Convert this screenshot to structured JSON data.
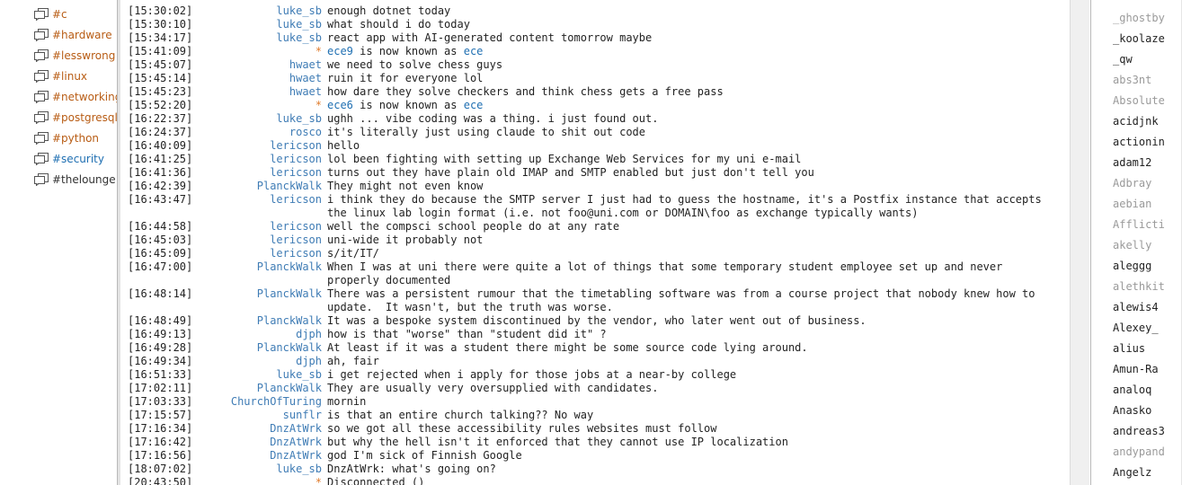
{
  "sidebar": {
    "channels": [
      {
        "label": "#c",
        "state": "unread"
      },
      {
        "label": "#hardware",
        "state": "unread"
      },
      {
        "label": "#lesswrong",
        "state": "unread"
      },
      {
        "label": "#linux",
        "state": "unread"
      },
      {
        "label": "#networking",
        "state": "unread"
      },
      {
        "label": "#postgresql",
        "state": "unread"
      },
      {
        "label": "#python",
        "state": "unread"
      },
      {
        "label": "#security",
        "state": "current"
      },
      {
        "label": "#thelounge",
        "state": "read"
      }
    ]
  },
  "messages": [
    {
      "ts": "[15:30:02]",
      "nick": "luke_sb",
      "type": "normal",
      "text": "enough dotnet today"
    },
    {
      "ts": "[15:30:10]",
      "nick": "luke_sb",
      "type": "normal",
      "text": "what should i do today"
    },
    {
      "ts": "[15:34:17]",
      "nick": "luke_sb",
      "type": "normal",
      "text": "react app with AI-generated content tomorrow maybe"
    },
    {
      "ts": "[15:41:09]",
      "nick": "*",
      "type": "nickchange",
      "from": "ece9",
      "mid": " is now known as ",
      "to": "ece"
    },
    {
      "ts": "[15:45:07]",
      "nick": "hwaet",
      "type": "normal",
      "text": "we need to solve chess guys"
    },
    {
      "ts": "[15:45:14]",
      "nick": "hwaet",
      "type": "normal",
      "text": "ruin it for everyone lol"
    },
    {
      "ts": "[15:45:23]",
      "nick": "hwaet",
      "type": "normal",
      "text": "how dare they solve checkers and think chess gets a free pass"
    },
    {
      "ts": "[15:52:20]",
      "nick": "*",
      "type": "nickchange",
      "from": "ece6",
      "mid": " is now known as ",
      "to": "ece"
    },
    {
      "ts": "[16:22:37]",
      "nick": "luke_sb",
      "type": "normal",
      "text": "ughh ... vibe coding was a thing. i just found out."
    },
    {
      "ts": "[16:24:37]",
      "nick": "rosco",
      "type": "normal",
      "text": "it's literally just using claude to shit out code"
    },
    {
      "ts": "[16:40:09]",
      "nick": "lericson",
      "type": "normal",
      "text": "hello"
    },
    {
      "ts": "[16:41:25]",
      "nick": "lericson",
      "type": "normal",
      "text": "lol been fighting with setting up Exchange Web Services for my uni e-mail"
    },
    {
      "ts": "[16:41:36]",
      "nick": "lericson",
      "type": "normal",
      "text": "turns out they have plain old IMAP and SMTP enabled but just don't tell you"
    },
    {
      "ts": "[16:42:39]",
      "nick": "PlanckWalk",
      "type": "normal",
      "text": "They might not even know"
    },
    {
      "ts": "[16:43:47]",
      "nick": "lericson",
      "type": "normal",
      "text": "i think they do because the SMTP server I just had to guess the hostname, it's a Postfix instance that accepts the linux lab login format (i.e. not foo@uni.com or DOMAIN\\foo as exchange typically wants)"
    },
    {
      "ts": "[16:44:58]",
      "nick": "lericson",
      "type": "normal",
      "text": "well the compsci school people do at any rate"
    },
    {
      "ts": "[16:45:03]",
      "nick": "lericson",
      "type": "normal",
      "text": "uni-wide it probably not"
    },
    {
      "ts": "[16:45:09]",
      "nick": "lericson",
      "type": "normal",
      "text": "s/it/IT/"
    },
    {
      "ts": "[16:47:00]",
      "nick": "PlanckWalk",
      "type": "normal",
      "text": "When I was at uni there were quite a lot of things that some temporary student employee set up and never properly documented"
    },
    {
      "ts": "[16:48:14]",
      "nick": "PlanckWalk",
      "type": "normal",
      "text": "There was a persistent rumour that the timetabling software was from a course project that nobody knew how to update.  It wasn't, but the truth was worse."
    },
    {
      "ts": "[16:48:49]",
      "nick": "PlanckWalk",
      "type": "normal",
      "text": "It was a bespoke system discontinued by the vendor, who later went out of business."
    },
    {
      "ts": "[16:49:13]",
      "nick": "djph",
      "type": "normal",
      "text": "how is that \"worse\" than \"student did it\" ?"
    },
    {
      "ts": "[16:49:28]",
      "nick": "PlanckWalk",
      "type": "normal",
      "text": "At least if it was a student there might be some source code lying around."
    },
    {
      "ts": "[16:49:34]",
      "nick": "djph",
      "type": "normal",
      "text": "ah, fair"
    },
    {
      "ts": "[16:51:33]",
      "nick": "luke_sb",
      "type": "normal",
      "text": "i get rejected when i apply for those jobs at a near-by college"
    },
    {
      "ts": "[17:02:11]",
      "nick": "PlanckWalk",
      "type": "normal",
      "text": "They are usually very oversupplied with candidates."
    },
    {
      "ts": "[17:03:33]",
      "nick": "ChurchOfTuring",
      "type": "normal",
      "text": "mornin"
    },
    {
      "ts": "[17:15:57]",
      "nick": "sunflr",
      "type": "normal",
      "text": "is that an entire church talking?? No way"
    },
    {
      "ts": "[17:16:34]",
      "nick": "DnzAtWrk",
      "type": "normal",
      "text": "so we got all these accessibility rules websites must follow"
    },
    {
      "ts": "[17:16:42]",
      "nick": "DnzAtWrk",
      "type": "normal",
      "text": "but why the hell isn't it enforced that they cannot use IP localization"
    },
    {
      "ts": "[17:16:56]",
      "nick": "DnzAtWrk",
      "type": "normal",
      "text": "god I'm sick of Finnish Google"
    },
    {
      "ts": "[18:07:02]",
      "nick": "luke_sb",
      "type": "normal",
      "text": "DnzAtWrk: what's going on?"
    },
    {
      "ts": "[20:43:50]",
      "nick": "*",
      "type": "system",
      "text": "Disconnected ()"
    }
  ],
  "users": [
    {
      "name": "_ghostby",
      "away": true
    },
    {
      "name": "_koolaze",
      "away": false
    },
    {
      "name": "_qw",
      "away": false
    },
    {
      "name": "abs3nt",
      "away": true
    },
    {
      "name": "Absolute",
      "away": true
    },
    {
      "name": "acidjnk",
      "away": false
    },
    {
      "name": "actionin",
      "away": false
    },
    {
      "name": "adam12",
      "away": false
    },
    {
      "name": "Adbray",
      "away": true
    },
    {
      "name": "aebian",
      "away": true
    },
    {
      "name": "Afflicti",
      "away": true
    },
    {
      "name": "akelly",
      "away": true
    },
    {
      "name": "aleggg",
      "away": false
    },
    {
      "name": "alethkit",
      "away": true
    },
    {
      "name": "alewis4",
      "away": false
    },
    {
      "name": "Alexey_",
      "away": false
    },
    {
      "name": "alius",
      "away": false
    },
    {
      "name": "Amun-Ra",
      "away": false
    },
    {
      "name": "analoq",
      "away": false
    },
    {
      "name": "Anasko",
      "away": false
    },
    {
      "name": "andreas3",
      "away": false
    },
    {
      "name": "andypand",
      "away": true
    },
    {
      "name": "Angelz",
      "away": false
    }
  ]
}
